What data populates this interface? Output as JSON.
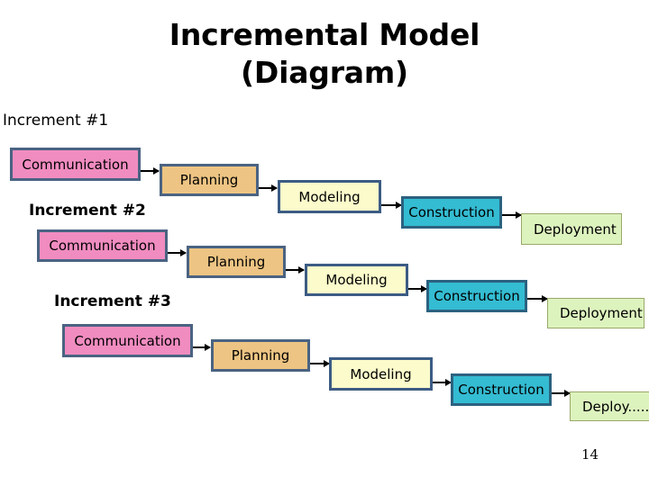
{
  "slide": {
    "title_line1": "Incremental Model",
    "title_line2": "(Diagram)",
    "page_number": "14",
    "colors": {
      "communication": "#F08CC0",
      "planning": "#EDC483",
      "modeling": "#FBFBCB",
      "construction": "#34BCD2",
      "deployment": "#DDF3BE",
      "box_border": "#4A6382",
      "deployment_border": "#9AA86B",
      "arrow": "#000000",
      "background": "#FFFFFF",
      "text": "#000000"
    }
  },
  "increments": [
    {
      "label": "Increment #1",
      "phases": [
        {
          "name": "Communication"
        },
        {
          "name": "Planning"
        },
        {
          "name": "Modeling"
        },
        {
          "name": "Construction"
        },
        {
          "name": "Deployment"
        }
      ]
    },
    {
      "label": "Increment #2",
      "phases": [
        {
          "name": "Communication"
        },
        {
          "name": "Planning"
        },
        {
          "name": "Modeling"
        },
        {
          "name": "Construction"
        },
        {
          "name": "Deployment"
        }
      ]
    },
    {
      "label": "Increment #3",
      "phases": [
        {
          "name": "Communication"
        },
        {
          "name": "Planning"
        },
        {
          "name": "Modeling"
        },
        {
          "name": "Construction"
        },
        {
          "name": "Deploy......"
        }
      ]
    }
  ]
}
